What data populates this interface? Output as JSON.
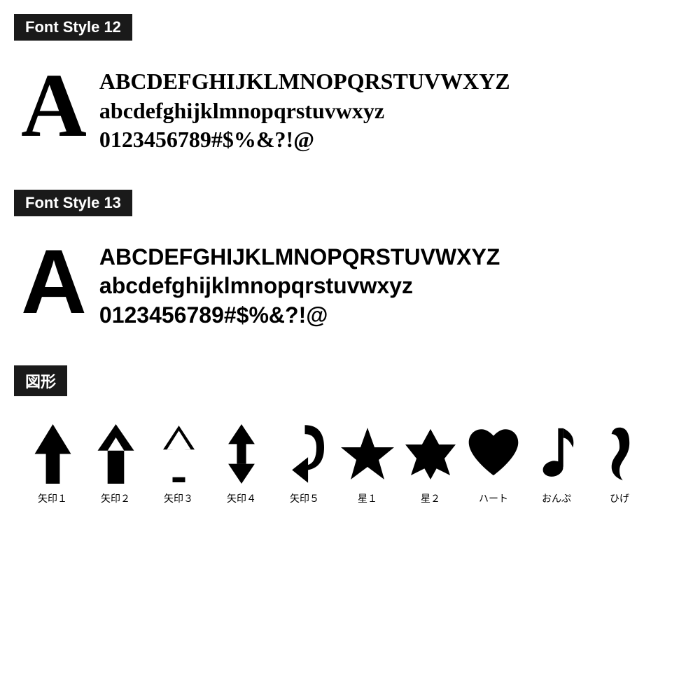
{
  "font12": {
    "label": "Font Style 12",
    "big_letter": "A",
    "line1": "ABCDEFGHIJKLMNOPQRSTUVWXYZ",
    "line2": "abcdefghijklmnopqrstuvwxyz",
    "line3": "0123456789#$%&?!@"
  },
  "font13": {
    "label": "Font Style 13",
    "big_letter": "A",
    "line1": "ABCDEFGHIJKLMNOPQRSTUVWXYZ",
    "line2": "abcdefghijklmnopqrstuvwxyz",
    "line3": "0123456789#$%&?!@"
  },
  "shapes": {
    "label": "図形",
    "items": [
      {
        "name": "矢印１",
        "type": "arrow1"
      },
      {
        "name": "矢印２",
        "type": "arrow2"
      },
      {
        "name": "矢印３",
        "type": "arrow3"
      },
      {
        "name": "矢印４",
        "type": "arrow4"
      },
      {
        "name": "矢印５",
        "type": "arrow5"
      },
      {
        "name": "星１",
        "type": "star1"
      },
      {
        "name": "星２",
        "type": "star2"
      },
      {
        "name": "ハート",
        "type": "heart"
      },
      {
        "name": "おんぷ",
        "type": "music"
      },
      {
        "name": "ひげ",
        "type": "mustache"
      }
    ]
  }
}
